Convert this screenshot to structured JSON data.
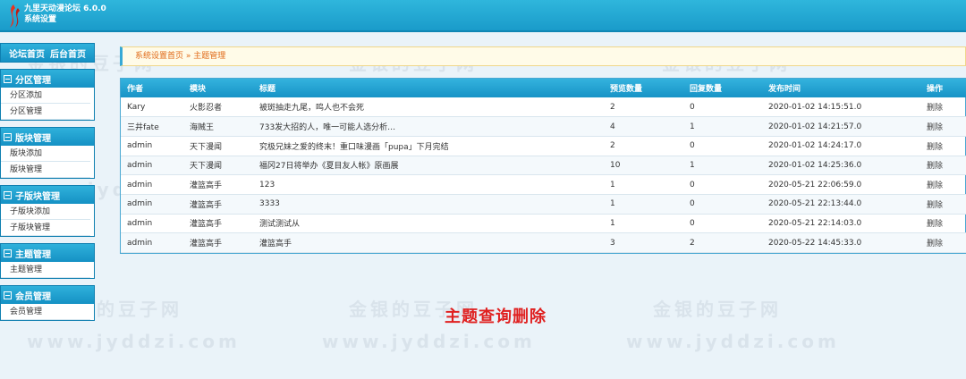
{
  "header": {
    "title_line1": "九里天动漫论坛 6.0.0",
    "title_line2": "系统设置"
  },
  "sidebar": {
    "top_links": [
      "论坛首页",
      "后台首页"
    ],
    "groups": [
      {
        "title": "分区管理",
        "items": [
          "分区添加",
          "分区管理"
        ]
      },
      {
        "title": "版块管理",
        "items": [
          "版块添加",
          "版块管理"
        ]
      },
      {
        "title": "子版块管理",
        "items": [
          "子版块添加",
          "子版块管理"
        ]
      },
      {
        "title": "主题管理",
        "items": [
          "主题管理"
        ]
      },
      {
        "title": "会员管理",
        "items": [
          "会员管理"
        ]
      }
    ]
  },
  "breadcrumb": "系统设置首页 » 主题管理",
  "table": {
    "headers": [
      "作者",
      "模块",
      "标题",
      "预览数量",
      "回复数量",
      "发布时间",
      "操作"
    ],
    "rows": [
      [
        "Kary",
        "火影忍者",
        "被斑抽走九尾，鸣人也不会死",
        "2",
        "0",
        "2020-01-02 14:15:51.0",
        "删除"
      ],
      [
        "三井fate",
        "海贼王",
        "733发大招的人，唯一可能人选分析…",
        "4",
        "1",
        "2020-01-02 14:21:57.0",
        "删除"
      ],
      [
        "admin",
        "天下漫闻",
        "究极兄妹之爱的终末！重口味漫画「pupa」下月完结",
        "2",
        "0",
        "2020-01-02 14:24:17.0",
        "删除"
      ],
      [
        "admin",
        "天下漫闻",
        "福冈27日将举办《夏目友人帐》原画展",
        "10",
        "1",
        "2020-01-02 14:25:36.0",
        "删除"
      ],
      [
        "admin",
        "灌篮高手",
        "123",
        "1",
        "0",
        "2020-05-21 22:06:59.0",
        "删除"
      ],
      [
        "admin",
        "灌篮高手",
        "3333",
        "1",
        "0",
        "2020-05-21 22:13:44.0",
        "删除"
      ],
      [
        "admin",
        "灌篮高手",
        "测试测试从",
        "1",
        "0",
        "2020-05-21 22:14:03.0",
        "删除"
      ],
      [
        "admin",
        "灌篮高手",
        "灌篮高手",
        "3",
        "2",
        "2020-05-22 14:45:33.0",
        "删除"
      ]
    ]
  },
  "caption": "主题查询删除",
  "watermark": {
    "line1": "金银的豆子网",
    "line2": "www.jyddzi.com"
  },
  "colors": {
    "header": "#1a9bca",
    "caption": "#e02020",
    "breadcrumb_text": "#e06a18"
  }
}
